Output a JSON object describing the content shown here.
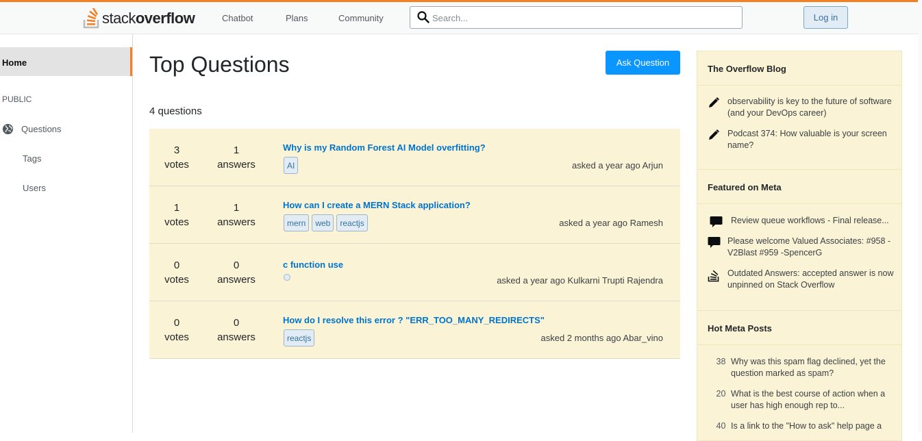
{
  "header": {
    "logo_text_light": "stack",
    "logo_text_bold": "overflow",
    "nav": [
      "Chatbot",
      "Plans",
      "Community"
    ],
    "search_placeholder": "Search...",
    "login_label": "Log in",
    "accent_color": "#f48024"
  },
  "sidebar": {
    "home": "Home",
    "section_label": "PUBLIC",
    "questions": "Questions",
    "tags": "Tags",
    "users": "Users"
  },
  "main": {
    "title": "Top Questions",
    "ask_button": "Ask Question",
    "count_label": "4 questions",
    "questions": [
      {
        "votes": "3",
        "votes_label": "votes",
        "answers": "1",
        "answers_label": "answers",
        "title": "Why is my Random Forest AI Model overfitting?",
        "tags": [
          "AI"
        ],
        "asked": "asked a year ago Arjun"
      },
      {
        "votes": "1",
        "votes_label": "votes",
        "answers": "1",
        "answers_label": "answers",
        "title": "How can I create a MERN Stack application?",
        "tags": [
          "mern",
          "web",
          "reactjs"
        ],
        "asked": "asked a year ago Ramesh"
      },
      {
        "votes": "0",
        "votes_label": "votes",
        "answers": "0",
        "answers_label": "answers",
        "title": "c function use",
        "tags": [],
        "asked": "asked a year ago Kulkarni Trupti Rajendra"
      },
      {
        "votes": "0",
        "votes_label": "votes",
        "answers": "0",
        "answers_label": "answers",
        "title": "How do I resolve this error ? \"ERR_TOO_MANY_REDIRECTS\"",
        "tags": [
          "reactjs"
        ],
        "asked": "asked 2 months ago Abar_vino"
      }
    ]
  },
  "widgets": {
    "blog": {
      "title": "The Overflow Blog",
      "items": [
        {
          "icon": "pencil-icon",
          "text": "observability is key to the future of software (and your DevOps career)"
        },
        {
          "icon": "pencil-icon",
          "text": "Podcast 374: How valuable is your screen name?"
        }
      ]
    },
    "meta": {
      "title": "Featured on Meta",
      "items": [
        {
          "icon": "speech-bubble-icon",
          "text": "Review queue workflows - Final release..."
        },
        {
          "icon": "speech-bubble-icon",
          "text": "Please welcome Valued Associates: #958 - V2Blast #959 -SpencerG"
        },
        {
          "icon": "stack-logo-icon",
          "text": "Outdated Answers: accepted answer is now unpinned on Stack Overflow"
        }
      ]
    },
    "hot": {
      "title": "Hot Meta Posts",
      "items": [
        {
          "num": "38",
          "text": "Why was this spam flag declined, yet the question marked as spam?"
        },
        {
          "num": "20",
          "text": "What is the best course of action when a user has high enough rep to..."
        },
        {
          "num": "40",
          "text": "Is a link to the \"How to ask\" help page a"
        }
      ]
    }
  }
}
